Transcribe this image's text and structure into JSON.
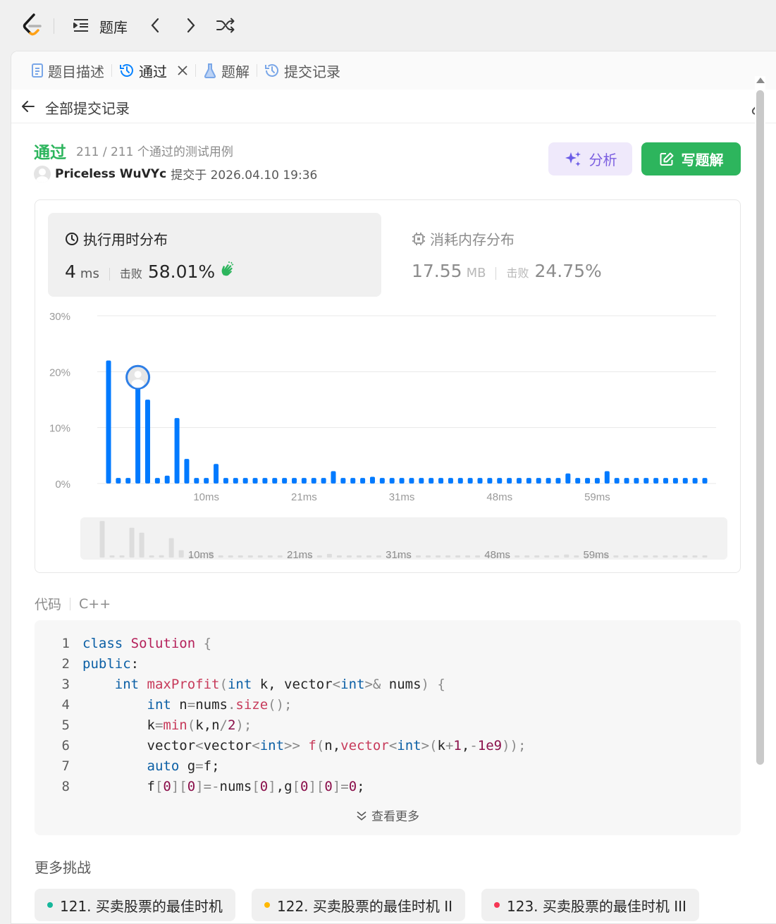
{
  "topbar": {
    "problems_label": "题库"
  },
  "tabs": [
    {
      "label": "题目描述"
    },
    {
      "label": "通过"
    },
    {
      "label": "题解"
    },
    {
      "label": "提交记录"
    }
  ],
  "subhead": {
    "title": "全部提交记录"
  },
  "submission": {
    "status": "通过",
    "tests": "211 / 211 个通过的测试用例",
    "author": "Priceless WuVYc",
    "submitted": "提交于 2026.04.10 19:36"
  },
  "buttons": {
    "analyze": "分析",
    "write_solution": "写题解"
  },
  "runtime": {
    "title": "执行用时分布",
    "value": "4",
    "unit": "ms",
    "beat_label": "击败",
    "beat": "58.01%"
  },
  "memory": {
    "title": "消耗内存分布",
    "value": "17.55",
    "unit": "MB",
    "beat_label": "击败",
    "beat": "24.75%"
  },
  "chart_data": {
    "type": "bar",
    "y_ticks": [
      "30%",
      "20%",
      "10%",
      "0%"
    ],
    "ylim": [
      0,
      30
    ],
    "x_tick_labels": [
      "10ms",
      "21ms",
      "31ms",
      "48ms",
      "59ms"
    ],
    "values": [
      22,
      1,
      1,
      18,
      15,
      1,
      1.4,
      11.7,
      4.4,
      1,
      1,
      3.5,
      1,
      1,
      1,
      1,
      1,
      1,
      1,
      1,
      1,
      1,
      1,
      2.2,
      1,
      1,
      1,
      1.2,
      1,
      1,
      1,
      1,
      1,
      1,
      1,
      1,
      1,
      1,
      1,
      1,
      1,
      1,
      1,
      1,
      1,
      1,
      1,
      1.8,
      1,
      1,
      1,
      2.2,
      1,
      1,
      1,
      1,
      1,
      1,
      1,
      1,
      1,
      1
    ],
    "highlight_index": 3,
    "colors": {
      "bar": "#007aff",
      "grid": "#e8e8e8",
      "mini_bar": "#dddddd"
    }
  },
  "code": {
    "label": "代码",
    "language": "C++",
    "more_label": "查看更多"
  },
  "more": {
    "title": "更多挑战",
    "items": [
      {
        "label": "121. 买卖股票的最佳时机",
        "color": "#16b79b"
      },
      {
        "label": "122. 买卖股票的最佳时机 II",
        "color": "#ffb800"
      },
      {
        "label": "123. 买卖股票的最佳时机 III",
        "color": "#f63654"
      }
    ]
  }
}
